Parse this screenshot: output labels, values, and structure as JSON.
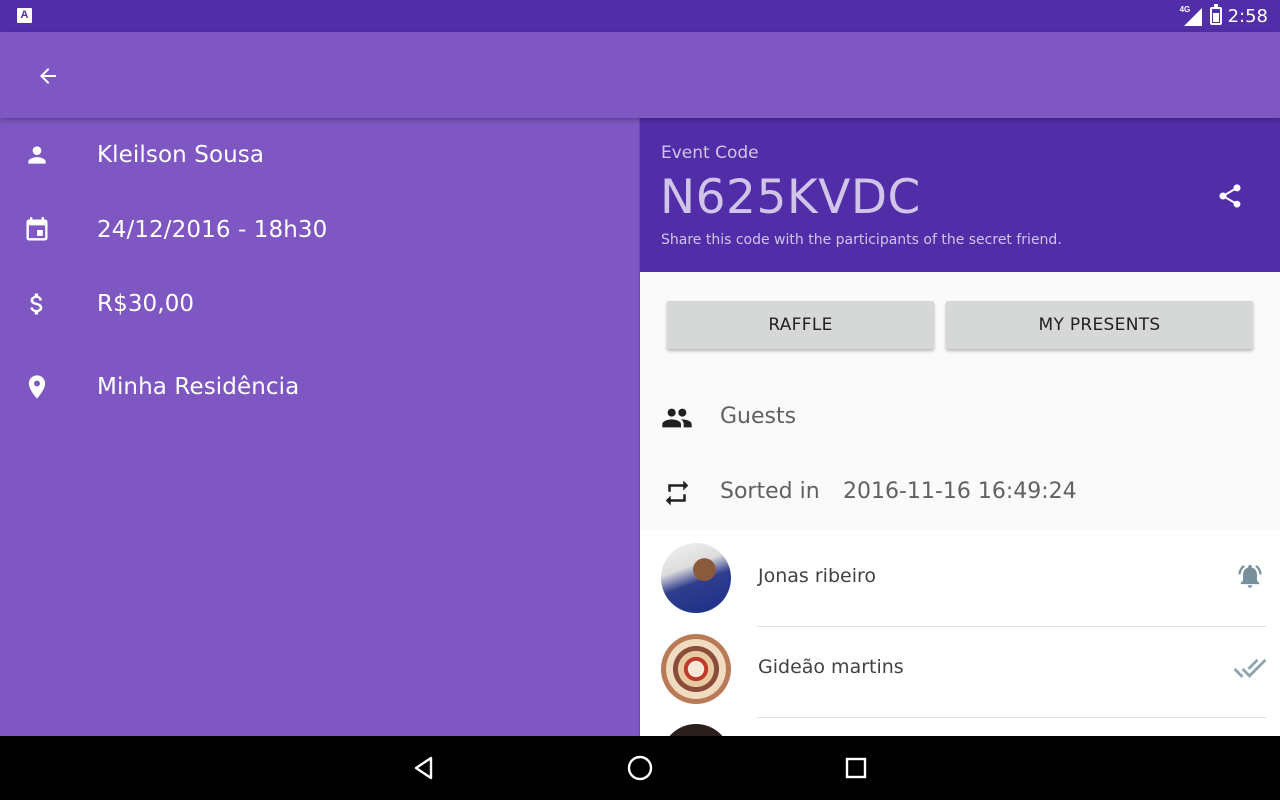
{
  "status_bar": {
    "app_icon": "A",
    "network": "4G",
    "time": "2:58",
    "icons": [
      "app-notification-icon",
      "signal-icon",
      "battery-charging-icon"
    ]
  },
  "app_bar": {
    "back_icon": "arrow-back-icon"
  },
  "details": [
    {
      "icon": "person-icon",
      "text": "Kleilson Sousa"
    },
    {
      "icon": "calendar-icon",
      "text": "24/12/2016 - 18h30"
    },
    {
      "icon": "dollar-icon",
      "text": "R$30,00"
    },
    {
      "icon": "location-pin-icon",
      "text": "Minha Residência"
    }
  ],
  "event": {
    "label": "Event Code",
    "code": "N625KVDC",
    "hint": "Share this code with the participants of the secret friend.",
    "share_icon": "share-icon"
  },
  "buttons": {
    "raffle": "RAFFLE",
    "my_presents": "MY PRESENTS"
  },
  "meta": {
    "guests_label": "Guests",
    "sorted_label": "Sorted in",
    "sorted_value": "2016-11-16 16:49:24"
  },
  "guests": [
    {
      "name": "Jonas ribeiro",
      "status_icon": "bell-ring-icon"
    },
    {
      "name": "Gideão martins",
      "status_icon": "double-check-icon"
    },
    {
      "name": "",
      "status_icon": ""
    }
  ],
  "nav": [
    "back-triangle-icon",
    "home-circle-icon",
    "recents-square-icon"
  ],
  "colors": {
    "primary": "#7e57c2",
    "primary_dark": "#512da8",
    "header_text": "#d1c4e9",
    "button_bg": "#d6d7d7",
    "status_icon": "#78909c"
  }
}
